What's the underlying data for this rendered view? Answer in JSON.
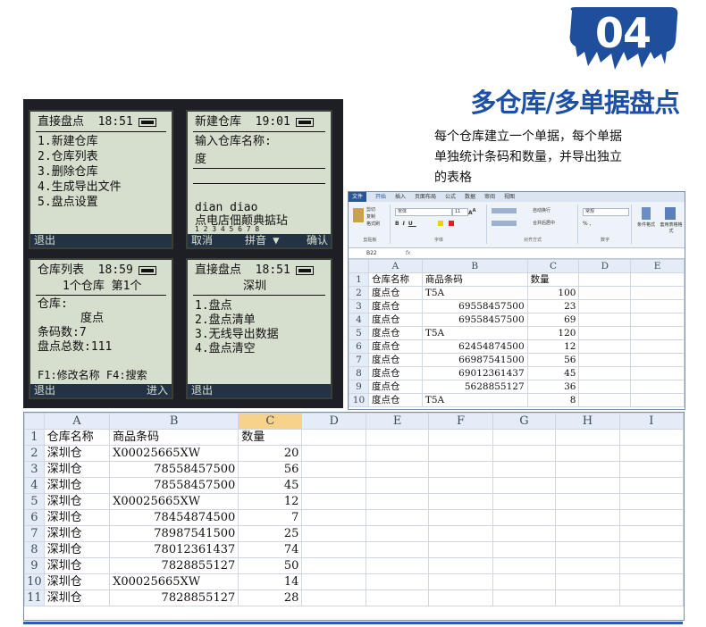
{
  "badge": {
    "number": "04",
    "color": "#1f4f9c"
  },
  "headline": "多仓库/多单据盘点",
  "description": [
    "每个仓库建立一个单据，每个单据",
    "单独统计条码和数量，并导出独立",
    "的表格"
  ],
  "lcd": {
    "screen1": {
      "title": "直接盘点",
      "time": "18:51",
      "lines": [
        "1.新建仓库",
        "2.仓库列表",
        "3.删除仓库",
        "4.生成导出文件",
        "5.盘点设置"
      ],
      "footer_left": "退出"
    },
    "screen2": {
      "title": "新建仓库",
      "time": "19:01",
      "prompt": "输入仓库名称:",
      "input": "度",
      "pinyin": "dian  diao",
      "candidates": "点电店佃颠典掂玷",
      "digits": "1 2 3 4 5 6 7 8",
      "footer_left": "取消",
      "footer_mid": "拼音 ▼",
      "footer_right": "确认"
    },
    "screen3": {
      "title": "仓库列表",
      "time": "18:59",
      "subtitle": "1个仓库 第1个",
      "label_warehouse": "仓库:",
      "warehouse": "度点",
      "barcode_count": "条码数:7",
      "total": "盘点总数:111",
      "fkeys": "F1:修改名称  F4:搜索",
      "footer_left": "退出",
      "footer_right": "进入"
    },
    "screen4": {
      "title": "直接盘点",
      "time": "18:51",
      "warehouse": "深圳",
      "lines": [
        "1.盘点",
        "2.盘点清单",
        "3.无线导出数据",
        "4.盘点清空"
      ],
      "footer_left": "退出"
    }
  },
  "excel_small": {
    "tabs": [
      "文件",
      "开始",
      "插入",
      "页面布局",
      "公式",
      "数据",
      "审阅",
      "视图"
    ],
    "font_name": "宋体",
    "font_size": "11",
    "number_format": "常规",
    "ribbon_groups": [
      "剪贴板",
      "字体",
      "对齐方式",
      "数字"
    ],
    "ribbon_buttons": {
      "cut": "剪切",
      "copy": "复制",
      "format_painter": "格式刷",
      "wrap": "自动换行",
      "merge": "合并后居中",
      "conditional": "条件格式",
      "table_format": "套用表格格式"
    },
    "name_box": "B22",
    "col_headers": [
      "",
      "A",
      "B",
      "C",
      "D",
      "E"
    ],
    "rows": [
      [
        "1",
        "仓库名称",
        "商品条码",
        "数量",
        "",
        ""
      ],
      [
        "2",
        "度点仓",
        "T5A",
        "100",
        "",
        ""
      ],
      [
        "3",
        "度点仓",
        "69558457500",
        "23",
        "",
        ""
      ],
      [
        "4",
        "度点仓",
        "69558457500",
        "69",
        "",
        ""
      ],
      [
        "5",
        "度点仓",
        "T5A",
        "120",
        "",
        ""
      ],
      [
        "6",
        "度点仓",
        "62454874500",
        "12",
        "",
        ""
      ],
      [
        "7",
        "度点仓",
        "66987541500",
        "56",
        "",
        ""
      ],
      [
        "8",
        "度点仓",
        "69012361437",
        "45",
        "",
        ""
      ],
      [
        "9",
        "度点仓",
        "5628855127",
        "36",
        "",
        ""
      ],
      [
        "10",
        "度点仓",
        "T5A",
        "8",
        "",
        ""
      ]
    ]
  },
  "excel_large": {
    "col_headers": [
      "",
      "A",
      "B",
      "C",
      "D",
      "E",
      "F",
      "G",
      "H",
      "I"
    ],
    "rows": [
      [
        "1",
        "仓库名称",
        "商品条码",
        "数量"
      ],
      [
        "2",
        "深圳仓",
        "X00025665XW",
        "20"
      ],
      [
        "3",
        "深圳仓",
        "78558457500",
        "56"
      ],
      [
        "4",
        "深圳仓",
        "78558457500",
        "45"
      ],
      [
        "5",
        "深圳仓",
        "X00025665XW",
        "12"
      ],
      [
        "6",
        "深圳仓",
        "78454874500",
        "7"
      ],
      [
        "7",
        "深圳仓",
        "78987541500",
        "25"
      ],
      [
        "8",
        "深圳仓",
        "78012361437",
        "74"
      ],
      [
        "9",
        "深圳仓",
        "7828855127",
        "50"
      ],
      [
        "10",
        "深圳仓",
        "X00025665XW",
        "14"
      ],
      [
        "11",
        "深圳仓",
        "7828855127",
        "28"
      ]
    ]
  }
}
